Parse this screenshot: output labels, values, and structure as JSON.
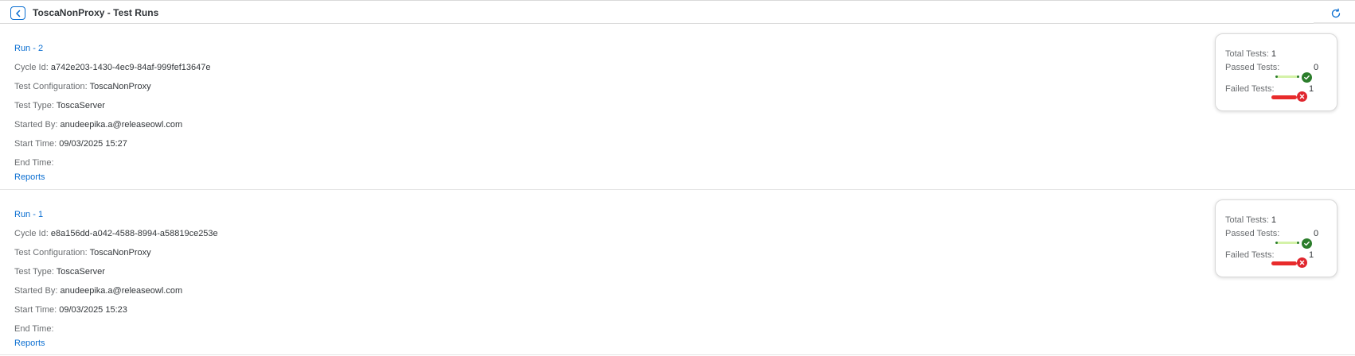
{
  "header": {
    "title": "ToscaNonProxy - Test Runs",
    "back_icon": "chevron-left-icon",
    "refresh_icon": "refresh-icon"
  },
  "labels": {
    "cycle_id": "Cycle Id:",
    "test_configuration": "Test Configuration:",
    "test_type": "Test Type:",
    "started_by": "Started By:",
    "start_time": "Start Time:",
    "end_time": "End Time:",
    "reports": "Reports",
    "total_tests": "Total Tests:",
    "passed_tests": "Passed Tests:",
    "failed_tests": "Failed Tests:"
  },
  "runs": [
    {
      "title": "Run - 2",
      "cycle_id": "a742e203-1430-4ec9-84af-999fef13647e",
      "test_configuration": "ToscaNonProxy",
      "test_type": "ToscaServer",
      "started_by": "anudeepika.a@releaseowl.com",
      "start_time": "09/03/2025 15:27",
      "end_time": "",
      "total": "1",
      "passed": "0",
      "failed": "1"
    },
    {
      "title": "Run - 1",
      "cycle_id": "e8a156dd-a042-4588-8994-a58819ce253e",
      "test_configuration": "ToscaNonProxy",
      "test_type": "ToscaServer",
      "started_by": "anudeepika.a@releaseowl.com",
      "start_time": "09/03/2025 15:23",
      "end_time": "",
      "total": "1",
      "passed": "0",
      "failed": "1"
    }
  ],
  "colors": {
    "accent": "#0a6ed1",
    "pass": "#2b7d2b",
    "pass_bar": "#d4f2a8",
    "fail": "#e82b2b"
  }
}
